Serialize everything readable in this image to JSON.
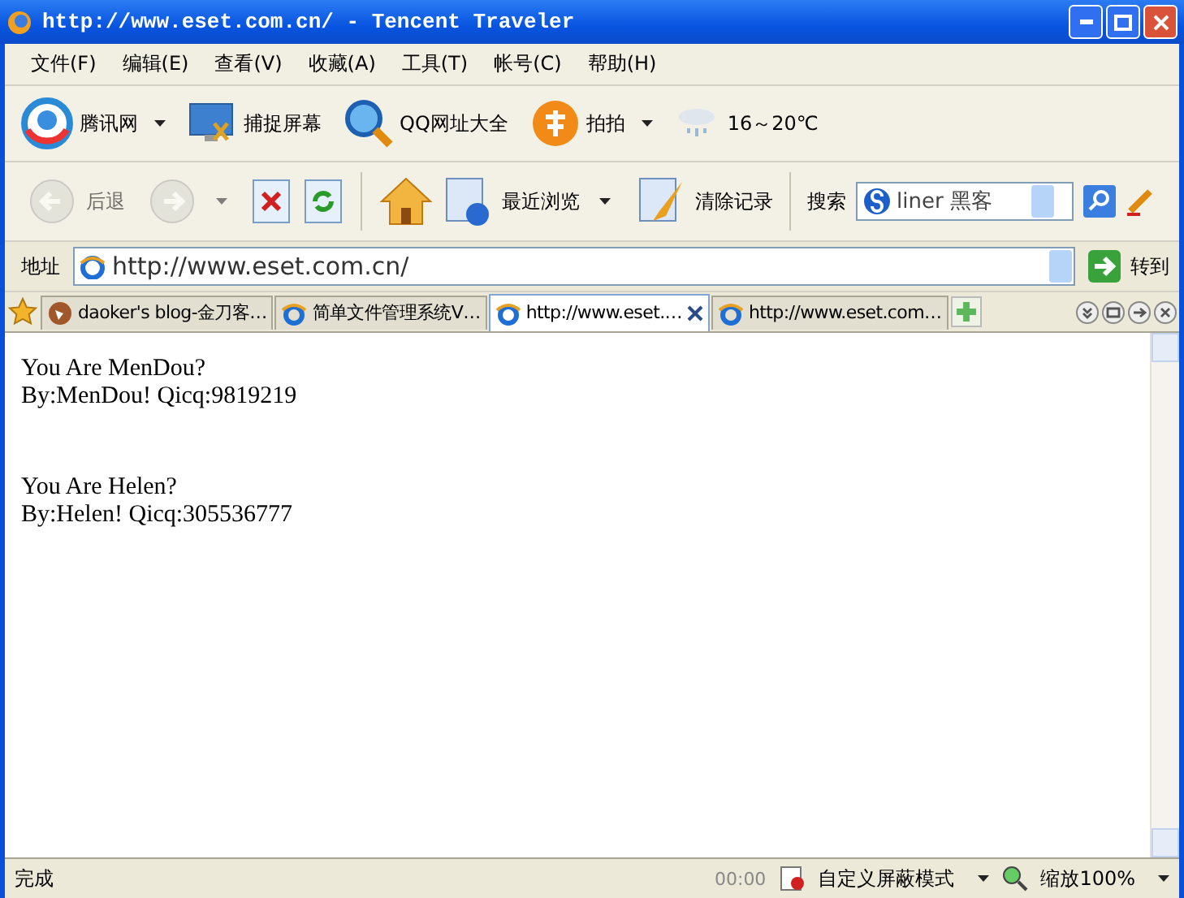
{
  "window": {
    "title": "http://www.eset.com.cn/ - Tencent Traveler"
  },
  "menu": [
    "文件(F)",
    "编辑(E)",
    "查看(V)",
    "收藏(A)",
    "工具(T)",
    "帐号(C)",
    "帮助(H)"
  ],
  "toolbar": [
    {
      "label": "腾讯网",
      "dropdown": true
    },
    {
      "label": "捕捉屏幕",
      "dropdown": false
    },
    {
      "label": "QQ网址大全",
      "dropdown": false
    },
    {
      "label": "拍拍",
      "dropdown": true
    }
  ],
  "weather": "16～20℃",
  "nav": [
    {
      "label": "后退",
      "dropdown": false,
      "disabled": true
    },
    {
      "dropdown": true,
      "disabled": true
    }
  ],
  "nav_labels": {
    "recent": "最近浏览",
    "clear": "清除记录"
  },
  "search": {
    "label": "搜索",
    "value": "liner 黑客"
  },
  "address": {
    "label": "地址",
    "url": "http://www.eset.com.cn/",
    "go": "转到"
  },
  "tabs": [
    {
      "label": "daoker's blog-金刀客…",
      "selected": false
    },
    {
      "label": "简单文件管理系统V…",
      "selected": false
    },
    {
      "label": "http://www.eset.…",
      "selected": true
    },
    {
      "label": "http://www.eset.com…",
      "selected": false
    }
  ],
  "content": [
    {
      "lines": [
        "You Are MenDou?",
        "By:MenDou! Qicq:9819219"
      ]
    },
    {
      "lines": [
        "You Are Helen?",
        "By:Helen! Qicq:305536777"
      ]
    }
  ],
  "status": {
    "text": "完成",
    "time": "00:00",
    "mode": "自定义屏蔽模式",
    "zoom": "缩放100%"
  }
}
